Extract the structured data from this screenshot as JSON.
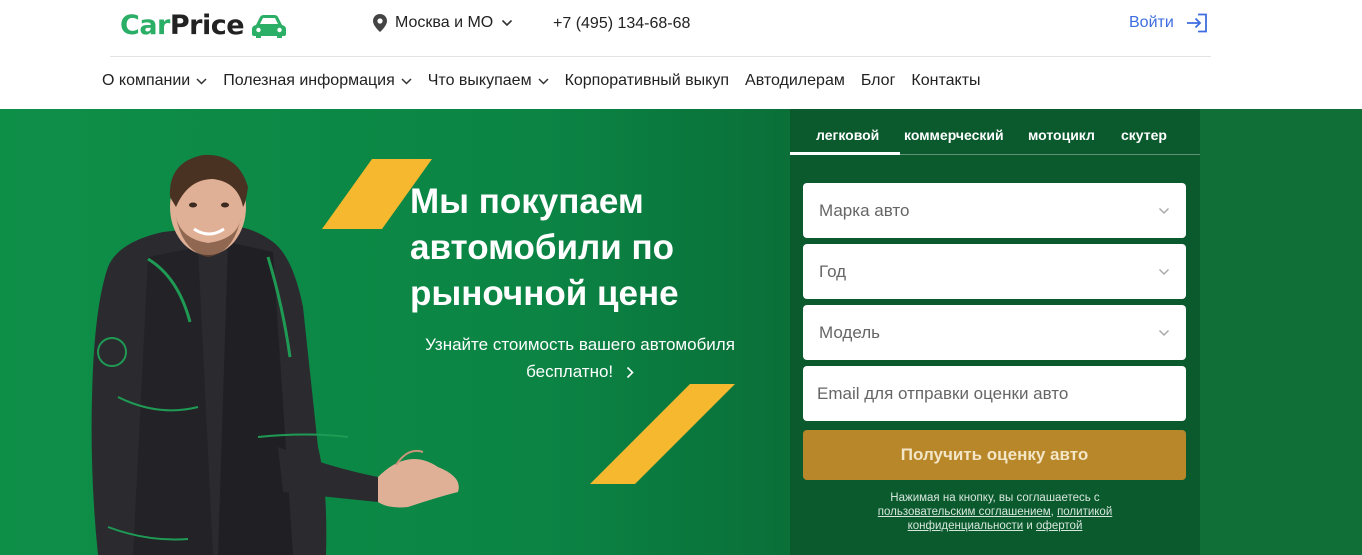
{
  "header": {
    "logo_car": "Car",
    "logo_price": "Price",
    "region": "Москва и МО",
    "phone": "+7 (495) 134-68-68",
    "login": "Войти"
  },
  "nav": {
    "items": [
      {
        "label": "О компании",
        "dropdown": true
      },
      {
        "label": "Полезная информация",
        "dropdown": true
      },
      {
        "label": "Что выкупаем",
        "dropdown": true
      },
      {
        "label": "Корпоративный выкуп",
        "dropdown": false
      },
      {
        "label": "Автодилерам",
        "dropdown": false
      },
      {
        "label": "Блог",
        "dropdown": false
      },
      {
        "label": "Контакты",
        "dropdown": false
      }
    ]
  },
  "hero": {
    "headline": "Мы покупаем автомобили по рыночной цене",
    "subtext": "Узнайте стоимость вашего автомобиля бесплатно!"
  },
  "form": {
    "tabs": [
      "легковой",
      "коммерческий",
      "мотоцикл",
      "скутер"
    ],
    "active_tab": "легковой",
    "fields": {
      "brand": "Марка авто",
      "year": "Год",
      "model": "Модель"
    },
    "email_placeholder": "Email для отправки оценки авто",
    "submit_label": "Получить оценку авто",
    "legal": {
      "prefix": "Нажимая на кнопку, вы соглашаетесь с",
      "link_agreement": "пользовательским соглашением",
      "link_policy": "политикой конфиденциальности",
      "and": "и",
      "link_offer": "офертой"
    }
  },
  "colors": {
    "brand_green": "#2bae66",
    "hero_green": "#0b8444",
    "panel_green": "#0a5a2e",
    "accent_yellow": "#f5b82e",
    "button_gold": "#b8872a",
    "link_blue": "#3e6de0"
  }
}
